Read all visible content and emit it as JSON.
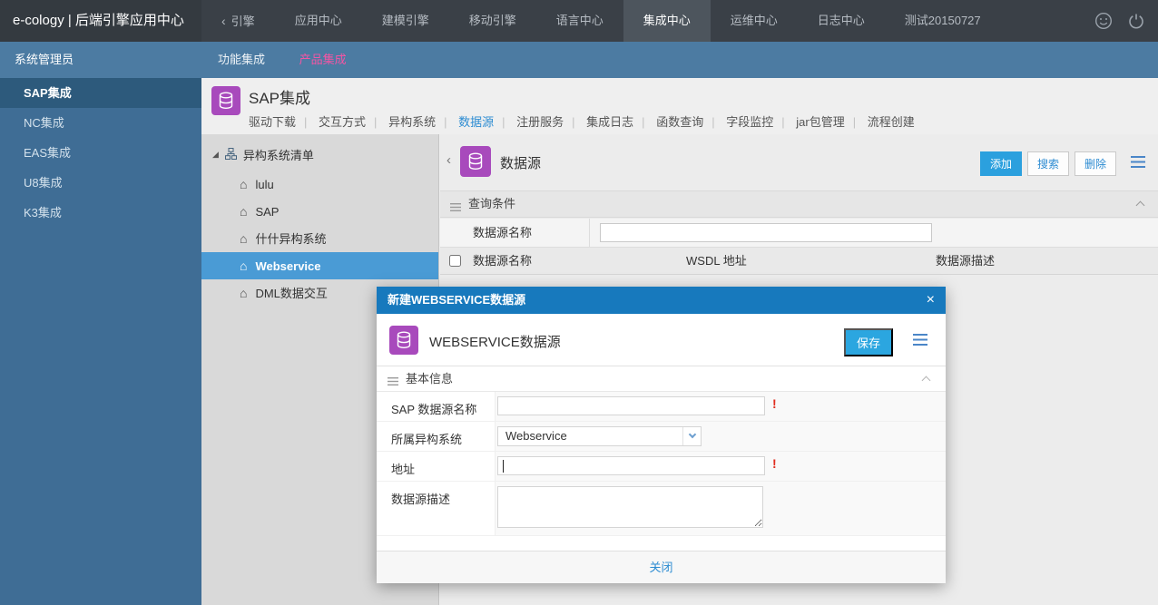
{
  "topbar": {
    "logo": "e-cology | 后端引擎应用中心",
    "back_tab": "引擎",
    "tabs": [
      {
        "label": "应用中心",
        "active": false
      },
      {
        "label": "建模引擎",
        "active": false
      },
      {
        "label": "移动引擎",
        "active": false
      },
      {
        "label": "语言中心",
        "active": false
      },
      {
        "label": "集成中心",
        "active": true
      },
      {
        "label": "运维中心",
        "active": false
      },
      {
        "label": "日志中心",
        "active": false
      },
      {
        "label": "测试20150727",
        "active": false
      }
    ]
  },
  "subnav": {
    "tabs": [
      {
        "label": "功能集成",
        "active": false
      },
      {
        "label": "产品集成",
        "active": true
      }
    ]
  },
  "sidebar": {
    "role": "系统管理员",
    "items": [
      {
        "label": "SAP集成",
        "active": true
      },
      {
        "label": "NC集成",
        "active": false
      },
      {
        "label": "EAS集成",
        "active": false
      },
      {
        "label": "U8集成",
        "active": false
      },
      {
        "label": "K3集成",
        "active": false
      }
    ]
  },
  "page": {
    "title": "SAP集成",
    "nav": [
      {
        "label": "驱动下载",
        "active": false
      },
      {
        "label": "交互方式",
        "active": false
      },
      {
        "label": "异构系统",
        "active": false
      },
      {
        "label": "数据源",
        "active": true
      },
      {
        "label": "注册服务",
        "active": false
      },
      {
        "label": "集成日志",
        "active": false
      },
      {
        "label": "函数查询",
        "active": false
      },
      {
        "label": "字段监控",
        "active": false
      },
      {
        "label": "jar包管理",
        "active": false
      },
      {
        "label": "流程创建",
        "active": false
      }
    ]
  },
  "tree": {
    "root": "异构系统清单",
    "items": [
      {
        "label": "lulu",
        "selected": false
      },
      {
        "label": "SAP",
        "selected": false
      },
      {
        "label": "什什异构系统",
        "selected": false
      },
      {
        "label": "Webservice",
        "selected": true
      },
      {
        "label": "DML数据交互",
        "selected": false
      }
    ]
  },
  "content": {
    "title": "数据源",
    "buttons": {
      "add": "添加",
      "search": "搜索",
      "delete": "删除"
    },
    "query_section": "查询条件",
    "query_field_label": "数据源名称",
    "query_field_value": "",
    "table_headers": [
      "数据源名称",
      "WSDL 地址",
      "数据源描述"
    ]
  },
  "modal": {
    "title": "新建WEBSERVICE数据源",
    "header": "WEBSERVICE数据源",
    "save_label": "保存",
    "section": "基本信息",
    "required_marker": "!",
    "fields": [
      {
        "label": "SAP 数据源名称",
        "type": "text",
        "value": "",
        "required": true
      },
      {
        "label": "所属异构系统",
        "type": "select",
        "value": "Webservice",
        "required": false
      },
      {
        "label": "地址",
        "type": "text",
        "value": "",
        "required": true
      },
      {
        "label": "数据源描述",
        "type": "textarea",
        "value": "",
        "required": false
      }
    ],
    "close_label": "关闭"
  },
  "icons": {
    "chevron_left": "‹",
    "tree_expand": "◢",
    "home": "⌂",
    "close": "×"
  },
  "colors": {
    "topbar_bg": "#3a4047",
    "sidebar_blue": "#3f6d95",
    "subnav_blue": "#4c7ba2",
    "active_side_item": "#2d5a7c",
    "accent_blue": "#2d8cd2",
    "accent_pink": "#f455a4",
    "icon_purple": "#a84abc",
    "modal_title_blue": "#1779bd",
    "button_blue": "#2ba0de",
    "selected_tree_blue": "#4a9bd5",
    "required_red": "#e02d1f"
  }
}
